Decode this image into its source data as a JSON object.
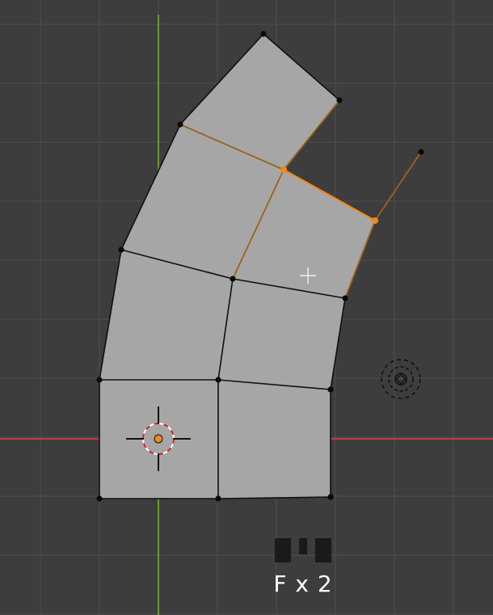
{
  "viewport": {
    "background_color": "#3d3d3d",
    "grid_color": "#4a4a4a",
    "x_axis_color": "#c83838",
    "y_axis_color": "#6e9a2a",
    "face_color": "#a6a6a6",
    "edge_color": "#101010",
    "selected_color": "#f08a1c",
    "vertex_color": "#0a0a0a"
  },
  "key_hint": {
    "caption": "F x 2",
    "icon": "keyboard-key-icon"
  },
  "cursor_3d": {
    "icon": "3d-cursor-icon"
  },
  "light_object": {
    "icon": "light-icon"
  },
  "mouse_cursor": {
    "icon": "crosshair-cursor-icon"
  }
}
